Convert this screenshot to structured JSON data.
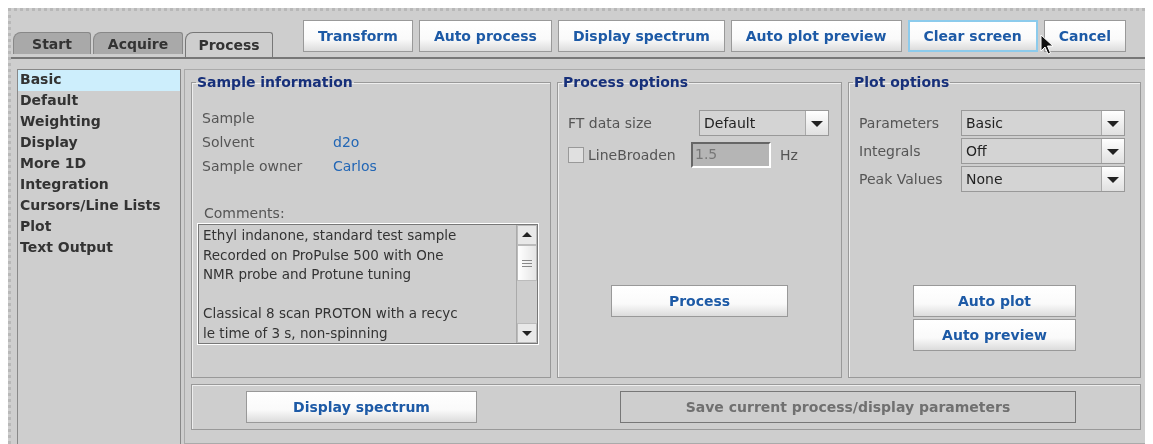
{
  "tabs": [
    {
      "label": "Start",
      "selected": false
    },
    {
      "label": "Acquire",
      "selected": false
    },
    {
      "label": "Process",
      "selected": true
    }
  ],
  "toolbar": [
    {
      "label": "Transform",
      "focused": false
    },
    {
      "label": "Auto process",
      "focused": false
    },
    {
      "label": "Display spectrum",
      "focused": false
    },
    {
      "label": "Auto plot preview",
      "focused": false
    },
    {
      "label": "Clear screen",
      "focused": true
    },
    {
      "label": "Cancel",
      "focused": false
    }
  ],
  "sidebar": {
    "items": [
      {
        "label": "Basic",
        "selected": true
      },
      {
        "label": "Default",
        "selected": false
      },
      {
        "label": "Weighting",
        "selected": false
      },
      {
        "label": "Display",
        "selected": false
      },
      {
        "label": "More 1D",
        "selected": false
      },
      {
        "label": "Integration",
        "selected": false
      },
      {
        "label": "Cursors/Line Lists",
        "selected": false
      },
      {
        "label": "Plot",
        "selected": false
      },
      {
        "label": "Text Output",
        "selected": false
      }
    ]
  },
  "sample_information": {
    "title": "Sample information",
    "fields": [
      {
        "label": "Sample"
      },
      {
        "label": "Solvent",
        "value": "d2o"
      },
      {
        "label": "Sample owner",
        "value": "Carlos"
      }
    ],
    "comments_label": "Comments:",
    "comments": [
      [
        "Ethyl indanone, standard test sample",
        "Recorded on ProPulse 500 with One",
        "NMR probe and Protune tuning"
      ],
      [
        "Classical 8 scan PROTON with a recyc",
        "le time of 3 s, non-spinning"
      ]
    ]
  },
  "process_options": {
    "title": "Process options",
    "ft_data_size": {
      "label": "FT data size",
      "value": "Default"
    },
    "line_broaden": {
      "label": "LineBroaden",
      "checked": false,
      "value": "1.5",
      "unit": "Hz"
    },
    "button": "Process"
  },
  "plot_options": {
    "title": "Plot options",
    "selects": [
      {
        "label": "Parameters",
        "value": "Basic"
      },
      {
        "label": "Integrals",
        "value": "Off"
      },
      {
        "label": "Peak Values",
        "value": "None"
      }
    ],
    "buttons": [
      "Auto plot",
      "Auto preview"
    ]
  },
  "bottom_buttons": [
    {
      "label": "Display spectrum",
      "disabled": false
    },
    {
      "label": "Save current process/display parameters",
      "disabled": true
    }
  ]
}
